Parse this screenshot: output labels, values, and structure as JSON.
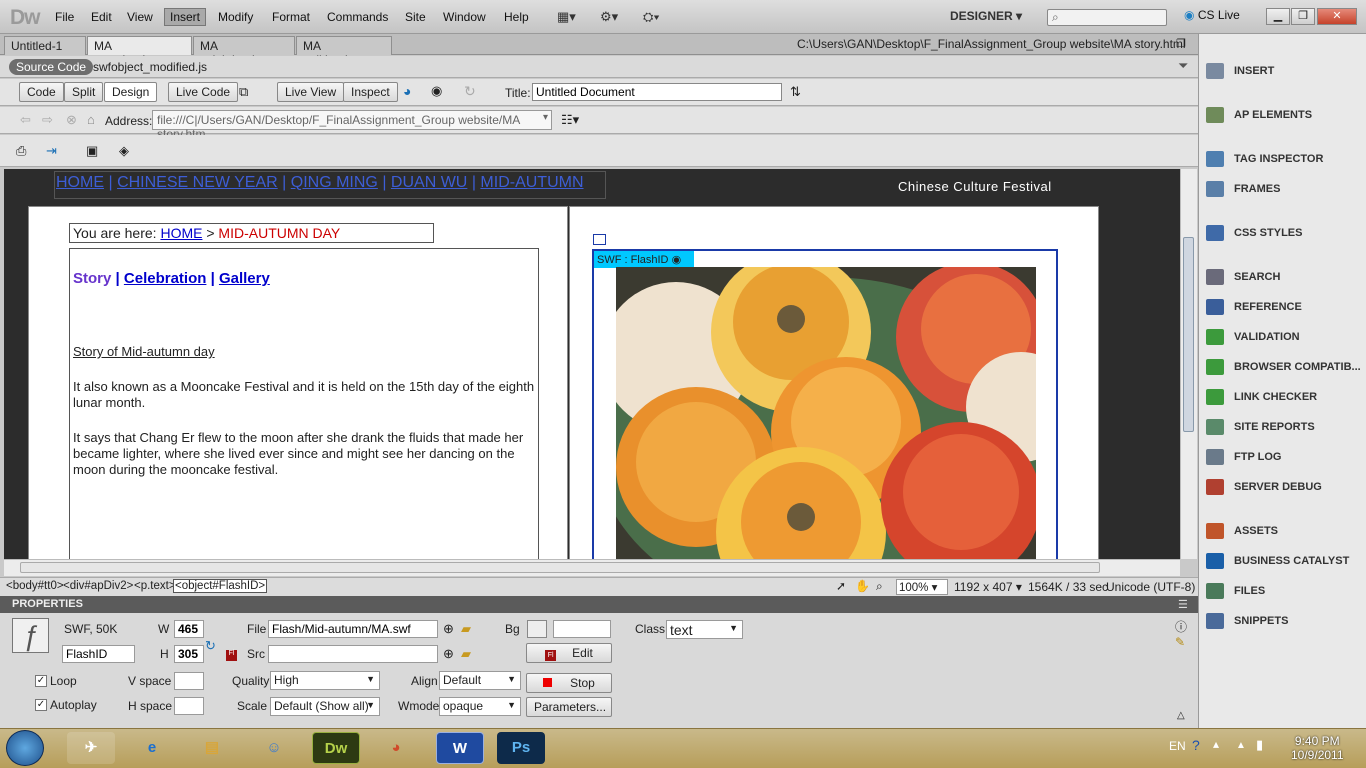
{
  "app": {
    "logo": "Dw",
    "workspace": "DESIGNER",
    "cs_live": "CS Live"
  },
  "menu": [
    "File",
    "Edit",
    "View",
    "Insert",
    "Modify",
    "Format",
    "Commands",
    "Site",
    "Window",
    "Help"
  ],
  "doc_tabs": [
    "Untitled-1",
    "MA story.html",
    "MA celeb.html",
    "MA gall.html"
  ],
  "doc_path": "C:\\Users\\GAN\\Desktop\\F_FinalAssignment_Group website\\MA story.html",
  "related": {
    "source": "Source Code",
    "file": "swfobject_modified.js"
  },
  "doc_toolbar": {
    "code": "Code",
    "split": "Split",
    "design": "Design",
    "live_code": "Live Code",
    "live_view": "Live View",
    "inspect": "Inspect",
    "title_label": "Title:",
    "title_value": "Untitled Document"
  },
  "address": {
    "label": "Address:",
    "value": "file:///C|/Users/GAN/Desktop/F_FinalAssignment_Group website/MA story.htm"
  },
  "page": {
    "nav": [
      "HOME",
      "CHINESE NEW YEAR",
      "QING MING",
      "DUAN WU",
      "MID-AUTUMN"
    ],
    "sep": "|",
    "site_title": "Chinese Culture Festival",
    "breadcrumb_prefix": "You are here:",
    "breadcrumb_home": "HOME",
    "breadcrumb_arrow": ">",
    "breadcrumb_current": "MID-AUTUMN DAY",
    "subnav": {
      "story": "Story",
      "celebration": "Celebration",
      "gallery": "Gallery"
    },
    "heading": "Story of Mid-autumn day",
    "para1": "It also known as a Mooncake Festival and it is held on the 15th day of the eighth lunar month.",
    "para2": "It says that Chang Er flew to the moon after she drank the fluids that made her became lighter, where she lived ever since and might see her dancing on the moon during the mooncake festival.",
    "swf_label": "SWF : FlashID"
  },
  "status": {
    "tags": [
      "<body#tt0>",
      "<div#apDiv2>",
      "<p.text>",
      "<object#FlashID>"
    ],
    "zoom": "100%",
    "size": "1192 x 407",
    "download": "1564K / 33 sec",
    "encoding": "Unicode (UTF-8)"
  },
  "properties": {
    "header": "PROPERTIES",
    "type": "SWF, 50K",
    "id": "FlashID",
    "w_label": "W",
    "w": "465",
    "h_label": "H",
    "h": "305",
    "file_label": "File",
    "file": "Flash/Mid-autumn/MA.swf",
    "src_label": "Src",
    "src": "",
    "bg_label": "Bg",
    "class_label": "Class",
    "class": "text",
    "edit": "Edit",
    "loop": "Loop",
    "autoplay": "Autoplay",
    "vspace": "V space",
    "hspace": "H space",
    "quality_label": "Quality",
    "quality": "High",
    "scale_label": "Scale",
    "scale": "Default (Show all)",
    "align_label": "Align",
    "align": "Default",
    "wmode_label": "Wmode",
    "wmode": "opaque",
    "stop": "Stop",
    "parameters": "Parameters..."
  },
  "panels": [
    "INSERT",
    "AP ELEMENTS",
    "TAG INSPECTOR",
    "FRAMES",
    "CSS STYLES",
    "SEARCH",
    "REFERENCE",
    "VALIDATION",
    "BROWSER COMPATIB...",
    "LINK CHECKER",
    "SITE REPORTS",
    "FTP LOG",
    "SERVER DEBUG",
    "ASSETS",
    "BUSINESS CATALYST",
    "FILES",
    "SNIPPETS"
  ],
  "taskbar": {
    "lang": "EN",
    "time": "9:40 PM",
    "date": "10/9/2011"
  },
  "colors": {
    "link": "#0000cc",
    "current": "#cc0000",
    "story": "#6633cc",
    "swf_tag": "#00c8ff"
  }
}
